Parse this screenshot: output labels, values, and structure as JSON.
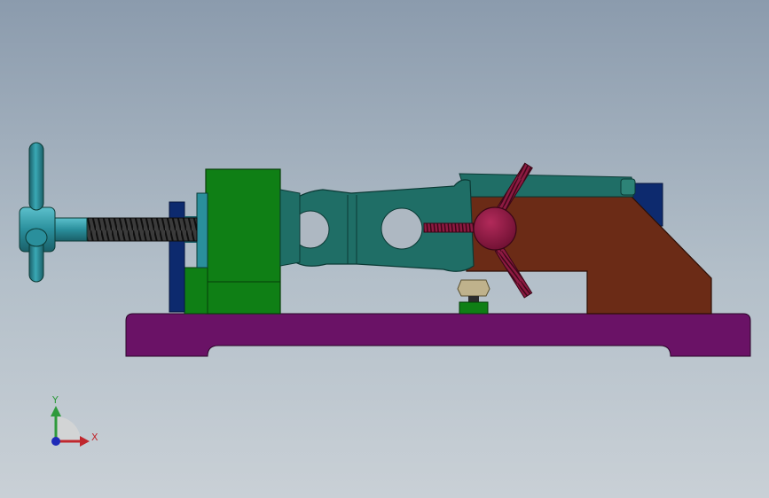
{
  "viewport": {
    "background_top": "#8b9bad",
    "background_bottom": "#c9d0d6"
  },
  "triad": {
    "x_label": "X",
    "y_label": "Y",
    "x_color": "#c0272d",
    "y_color": "#2e9a3c",
    "z_color": "#1f2bb8"
  },
  "model": {
    "base_color": "#6a1266",
    "spindle_color": "#2a8f9c",
    "screw_color": "#2c2c2c",
    "green_block_color": "#0f7f15",
    "navy_plate_color": "#0d2a6e",
    "link_color": "#1f6e66",
    "body_color": "#6b2b16",
    "knob_color": "#8d1a42",
    "handle_color": "#a03a6a",
    "pin_color": "#bfb28c"
  }
}
